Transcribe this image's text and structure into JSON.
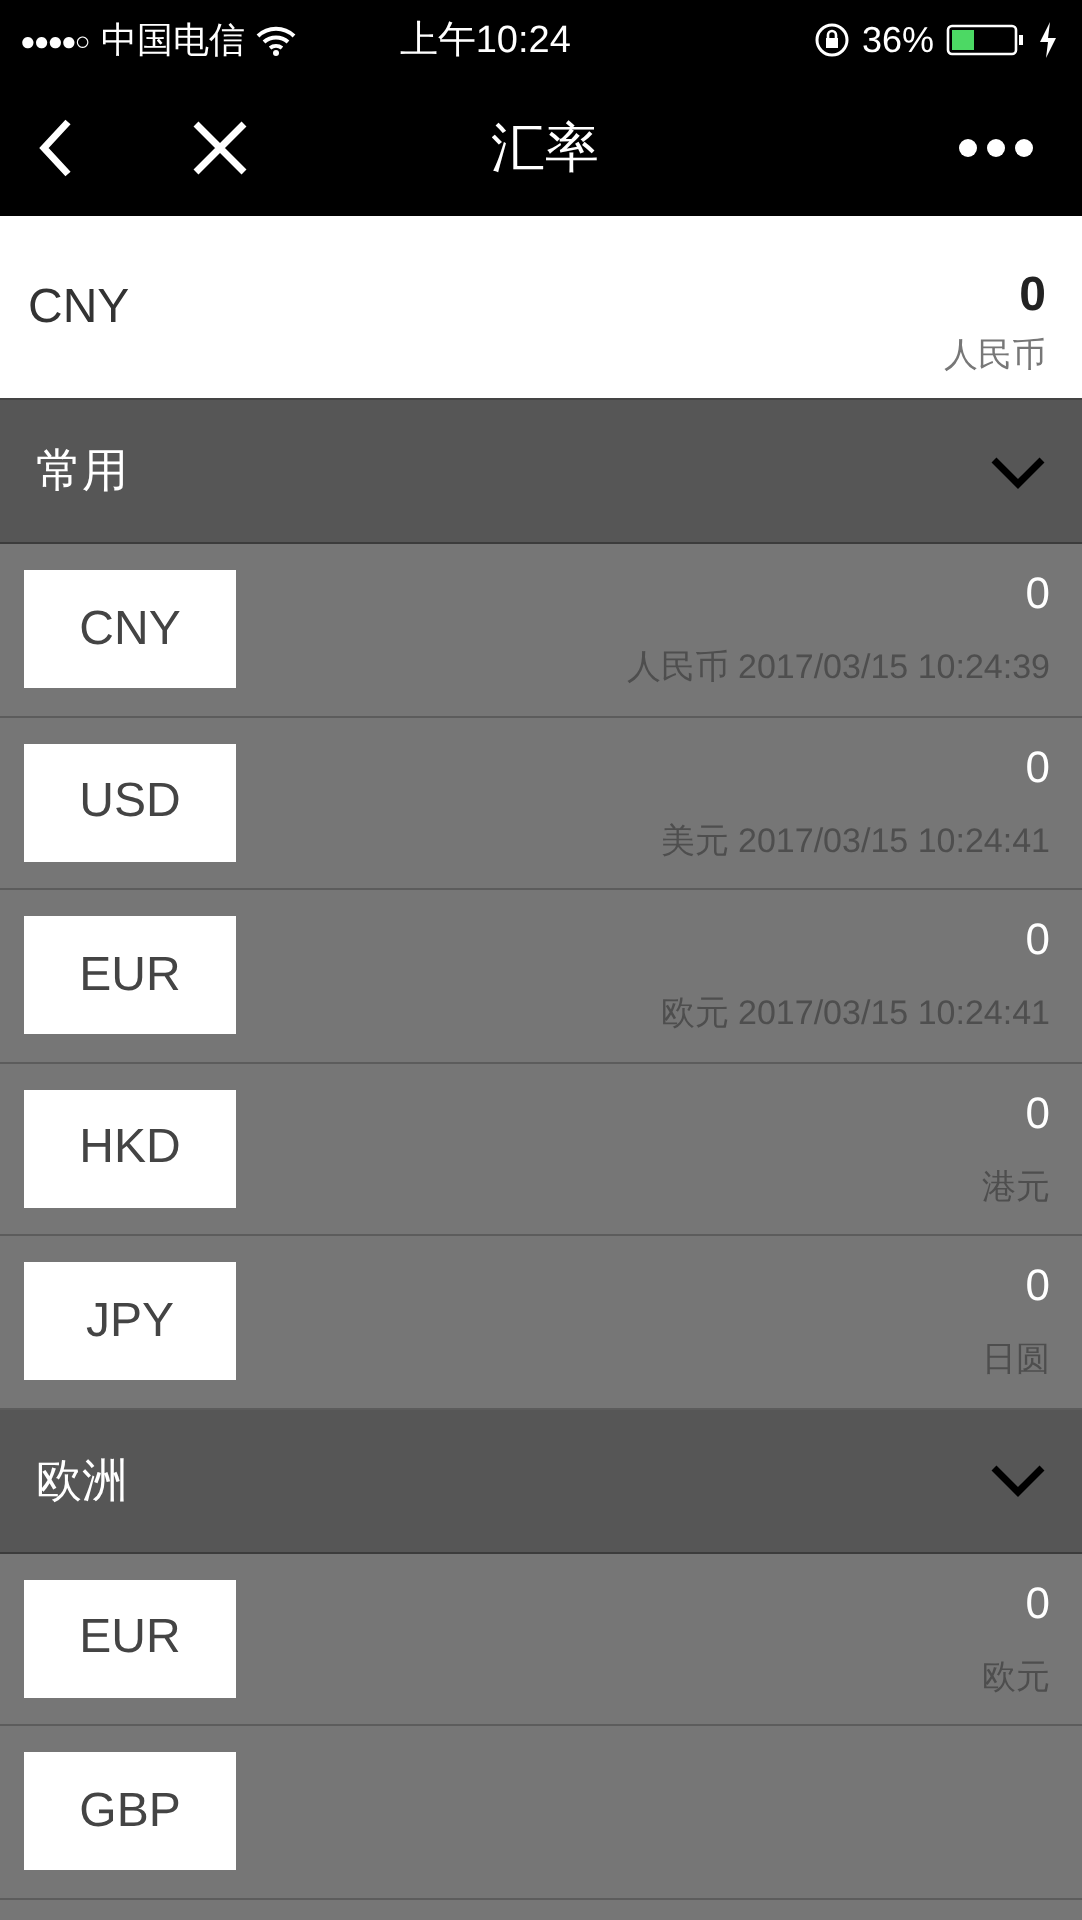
{
  "status_bar": {
    "signal": "●●●●○",
    "carrier": "中国电信",
    "time": "上午10:24",
    "battery_percent": "36%"
  },
  "nav": {
    "title": "汇率"
  },
  "base": {
    "code": "CNY",
    "amount": "0",
    "name": "人民币"
  },
  "groups": [
    {
      "title": "常用",
      "expanded": true,
      "items": [
        {
          "code": "CNY",
          "amount": "0",
          "note": "人民币 2017/03/15 10:24:39"
        },
        {
          "code": "USD",
          "amount": "0",
          "note": "美元 2017/03/15 10:24:41"
        },
        {
          "code": "EUR",
          "amount": "0",
          "note": "欧元 2017/03/15 10:24:41"
        },
        {
          "code": "HKD",
          "amount": "0",
          "note": "港元"
        },
        {
          "code": "JPY",
          "amount": "0",
          "note": "日圆"
        }
      ]
    },
    {
      "title": "欧洲",
      "expanded": true,
      "items": [
        {
          "code": "EUR",
          "amount": "0",
          "note": "欧元"
        },
        {
          "code": "GBP"
        }
      ]
    }
  ]
}
